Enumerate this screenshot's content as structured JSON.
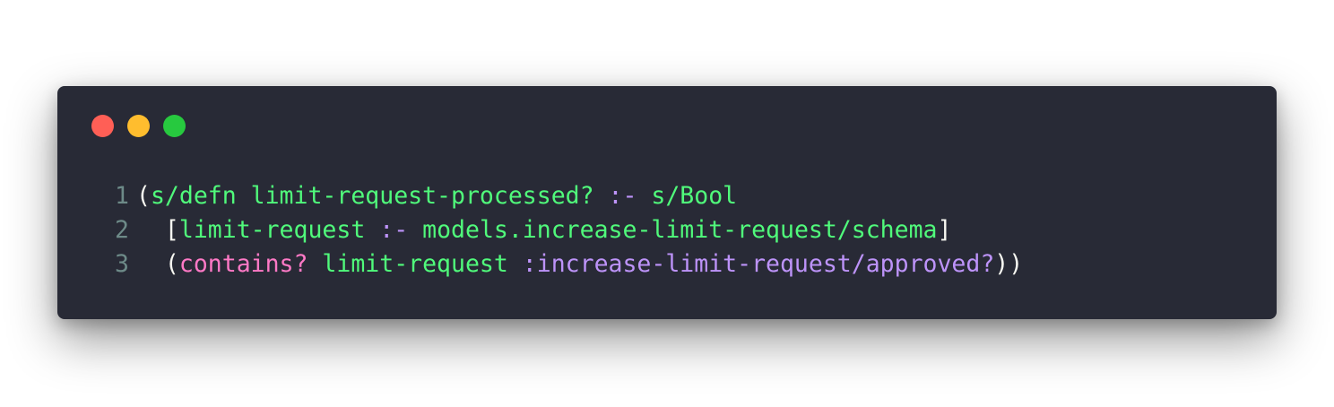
{
  "window": {
    "controls": [
      "close",
      "minimize",
      "maximize"
    ],
    "colors": {
      "background": "#282a36",
      "close": "#ff5f56",
      "minimize": "#ffbd2e",
      "maximize": "#27c93f"
    }
  },
  "code": {
    "lines": [
      {
        "number": "1",
        "tokens": [
          {
            "text": "(",
            "style": "punct"
          },
          {
            "text": "s/defn limit-request-processed? ",
            "style": "green"
          },
          {
            "text": ":-",
            "style": "purple"
          },
          {
            "text": " s/Bool",
            "style": "green"
          }
        ]
      },
      {
        "number": "2",
        "tokens": [
          {
            "text": "  [",
            "style": "punct"
          },
          {
            "text": "limit-request ",
            "style": "green"
          },
          {
            "text": ":-",
            "style": "purple"
          },
          {
            "text": " models.increase-limit-request/schema",
            "style": "green"
          },
          {
            "text": "]",
            "style": "punct"
          }
        ]
      },
      {
        "number": "3",
        "tokens": [
          {
            "text": "  (",
            "style": "punct"
          },
          {
            "text": "contains? ",
            "style": "pink"
          },
          {
            "text": "limit-request ",
            "style": "green"
          },
          {
            "text": ":increase-limit-request/approved?",
            "style": "purple"
          },
          {
            "text": "))",
            "style": "punct"
          }
        ]
      }
    ]
  }
}
